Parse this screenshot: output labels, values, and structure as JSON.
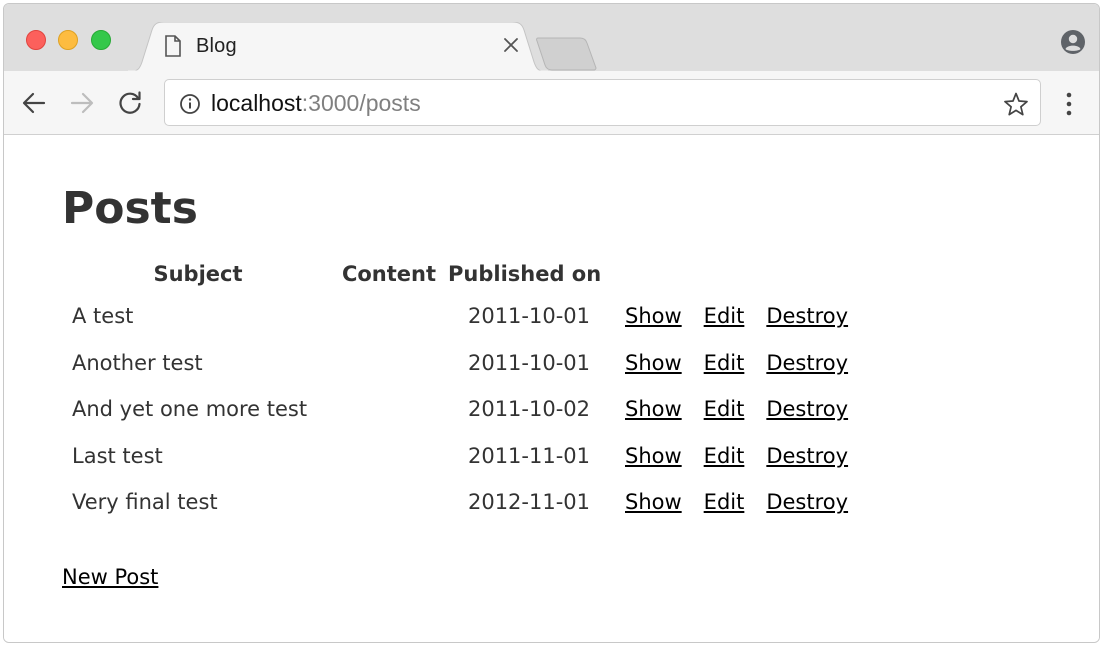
{
  "browser": {
    "tab_title": "Blog",
    "url_host": "localhost",
    "url_path": ":3000/posts"
  },
  "icons": {
    "page": "document-icon",
    "close": "close-icon",
    "profile": "profile-icon",
    "back": "back-arrow-icon",
    "forward": "forward-arrow-icon",
    "reload": "reload-icon",
    "info": "info-icon",
    "bookmark": "star-icon",
    "menu": "kebab-menu-icon"
  },
  "page": {
    "title": "Posts",
    "columns": [
      "Subject",
      "Content",
      "Published on"
    ],
    "rows": [
      {
        "subject": "A test",
        "content": "",
        "published_on": "2011-10-01",
        "show": "Show",
        "edit": "Edit",
        "destroy": "Destroy"
      },
      {
        "subject": "Another test",
        "content": "",
        "published_on": "2011-10-01",
        "show": "Show",
        "edit": "Edit",
        "destroy": "Destroy"
      },
      {
        "subject": "And yet one more test",
        "content": "",
        "published_on": "2011-10-02",
        "show": "Show",
        "edit": "Edit",
        "destroy": "Destroy"
      },
      {
        "subject": "Last test",
        "content": "",
        "published_on": "2011-11-01",
        "show": "Show",
        "edit": "Edit",
        "destroy": "Destroy"
      },
      {
        "subject": "Very final test",
        "content": "",
        "published_on": "2012-11-01",
        "show": "Show",
        "edit": "Edit",
        "destroy": "Destroy"
      }
    ],
    "new_post_label": "New Post"
  },
  "colors": {
    "close_red": "#fc605c",
    "minimize_yellow": "#fdbc40",
    "zoom_green": "#34c84a",
    "text": "#333333",
    "link": "#000000"
  }
}
